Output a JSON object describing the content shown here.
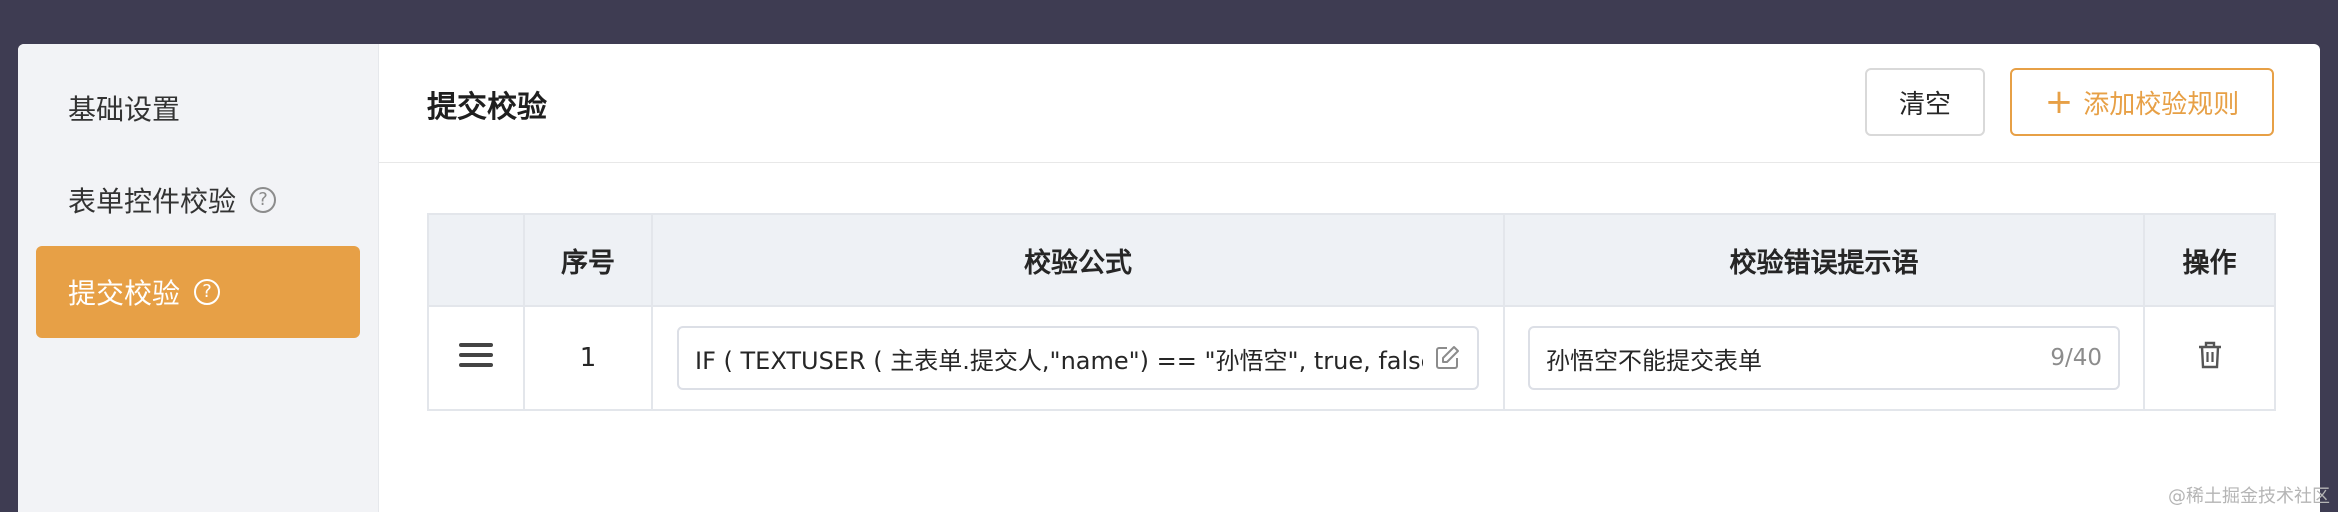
{
  "sidebar": {
    "items": [
      {
        "label": "基础设置",
        "has_help": false,
        "active": false
      },
      {
        "label": "表单控件校验",
        "has_help": true,
        "active": false
      },
      {
        "label": "提交校验",
        "has_help": true,
        "active": true
      }
    ],
    "help_glyph": "?"
  },
  "header": {
    "title": "提交校验",
    "clear_label": "清空",
    "add_label": "添加校验规则",
    "add_icon": "plus-icon"
  },
  "table": {
    "columns": [
      "",
      "序号",
      "校验公式",
      "校验错误提示语",
      "操作"
    ],
    "rows": [
      {
        "index": "1",
        "formula": "IF ( TEXTUSER ( 主表单.提交人,\"name\") == \"孙悟空\", true, false)",
        "message": "孙悟空不能提交表单",
        "counter": "9/40"
      }
    ]
  },
  "watermark": "@稀土掘金技术社区",
  "colors": {
    "accent": "#e7a046",
    "backdrop": "#3e3c52",
    "sidebar_bg": "#f2f3f6",
    "header_bg": "#eef1f5"
  }
}
